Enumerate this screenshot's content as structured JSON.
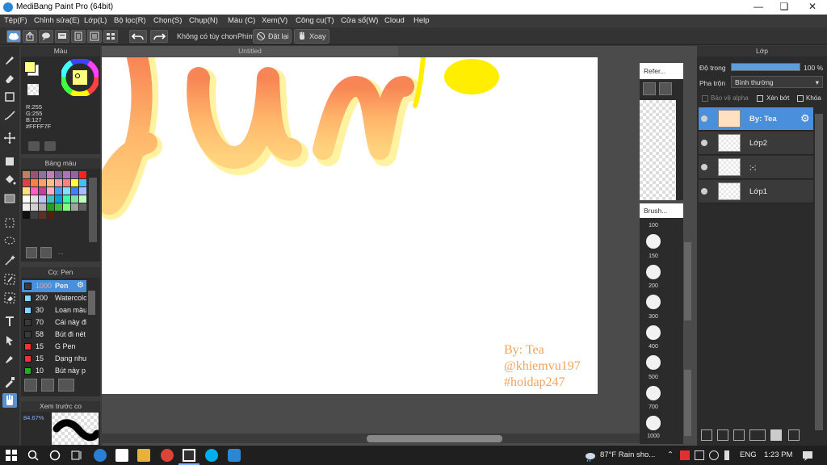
{
  "window": {
    "title": "MediBang Paint Pro (64bit)"
  },
  "menu": [
    "Tệp(F)",
    "Chỉnh sửa(E)",
    "Lớp(L)",
    "Bộ lọc(R)",
    "Chọn(S)",
    "Chụp(N)",
    "Màu (C)",
    "Xem(V)",
    "Công cụ(T)",
    "Cửa sổ(W)",
    "Cloud",
    "Help"
  ],
  "toolbar": {
    "no_option": "Không có tùy chọn",
    "key_label": "Phím",
    "reset_label": "Đặt lại",
    "rotate_label": "Xoay"
  },
  "color_panel": {
    "title": "Màu",
    "r": "R:255",
    "g": "G:255",
    "b": "B:127",
    "hex": "#FFFF7F",
    "primary_color": "#ffff7f",
    "secondary_color": "#ffffff"
  },
  "palette_panel": {
    "title": "Bảng màu",
    "more": "...",
    "colors": [
      "#c08060",
      "#a05070",
      "#9070a0",
      "#c080b0",
      "#8060a0",
      "#b070c0",
      "#a060a0",
      "#ff2020",
      "#e04040",
      "#ff8040",
      "#ffa060",
      "#ffc080",
      "#f0a0a0",
      "#ff8080",
      "#ffff40",
      "#40c0ff",
      "#ffe080",
      "#ff60c0",
      "#c040a0",
      "#ffb0c0",
      "#40a0ff",
      "#80e0ff",
      "#4080ff",
      "#a0c0ff",
      "#ffffff",
      "#e0e0e0",
      "#c0c0ff",
      "#40c0c0",
      "#00a0e0",
      "#40ffa0",
      "#80e0a0",
      "#c0ffc0",
      "#f0f0f0",
      "#d0d0d0",
      "#b0b0b0",
      "#20a020",
      "#40c040",
      "#80ff80",
      "#a0a0a0",
      "#606060",
      "#101010",
      "#404040",
      "#603020",
      "#502010"
    ]
  },
  "brush_panel": {
    "title": "Cọ: Pen",
    "items": [
      {
        "size": "1000",
        "name": "Pen",
        "color": "#3a3a3a"
      },
      {
        "size": "200",
        "name": "Watercolor",
        "color": "#7fd7ff"
      },
      {
        "size": "30",
        "name": "Loan màu",
        "color": "#7fd7ff"
      },
      {
        "size": "70",
        "name": "Cái này đi",
        "color": "#3a3a3a"
      },
      {
        "size": "58",
        "name": "Bút đi nét",
        "color": "#3a3a3a"
      },
      {
        "size": "15",
        "name": "G Pen",
        "color": "#ff3030"
      },
      {
        "size": "15",
        "name": "Dạng như",
        "color": "#ff3030"
      },
      {
        "size": "10",
        "name": "Bút này p",
        "color": "#20b020"
      }
    ]
  },
  "preview_panel": {
    "title": "Xem trước co",
    "zoom": "84.67%"
  },
  "canvas": {
    "tab_title": "Untitled"
  },
  "reference_panel": {
    "title": "Refer..."
  },
  "brush_size_panel": {
    "title": "Brush...",
    "sizes": [
      "100",
      "150",
      "200",
      "300",
      "400",
      "500",
      "700",
      "1000"
    ]
  },
  "layer_panel": {
    "title": "Lớp",
    "opacity_label": "Độ trong",
    "opacity_value": "100 %",
    "opacity": 100,
    "blend_label": "Pha trộn",
    "blend_value": "Bình thường",
    "protect_alpha": "Bảo vệ alpha",
    "clipping": "Xén bớt",
    "lock": "Khóa",
    "layers": [
      {
        "name": "By: Tea",
        "selected": true
      },
      {
        "name": "Lớp2",
        "selected": false
      },
      {
        "name": ";-;",
        "selected": false
      },
      {
        "name": "Lớp1",
        "selected": false
      }
    ]
  },
  "watermark": {
    "line1": "By: Tea",
    "line2": "@khiemvu197",
    "line3": "#hoidap247"
  },
  "taskbar": {
    "weather": "87°F  Rain sho...",
    "lang": "ENG",
    "time": "1:23 PM"
  }
}
